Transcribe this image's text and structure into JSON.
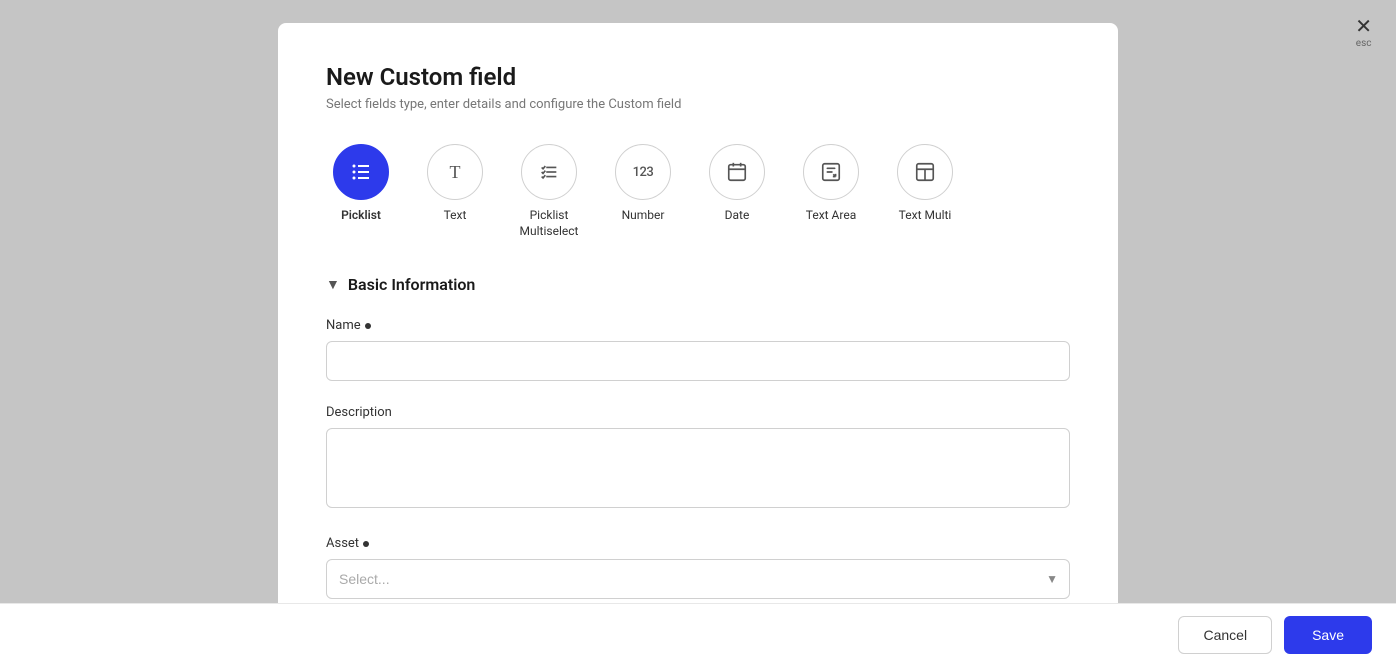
{
  "modal": {
    "title": "New Custom field",
    "subtitle": "Select fields type, enter details and configure the Custom field"
  },
  "close": {
    "icon_label": "✕",
    "esc_label": "esc"
  },
  "field_types": [
    {
      "id": "picklist",
      "label": "Picklist",
      "active": true,
      "icon": "list"
    },
    {
      "id": "text",
      "label": "Text",
      "active": false,
      "icon": "T"
    },
    {
      "id": "picklist-multiselect",
      "label": "Picklist\nMultiselect",
      "active": false,
      "icon": "list-check"
    },
    {
      "id": "number",
      "label": "Number",
      "active": false,
      "icon": "123"
    },
    {
      "id": "date",
      "label": "Date",
      "active": false,
      "icon": "calendar"
    },
    {
      "id": "text-area",
      "label": "Text Area",
      "active": false,
      "icon": "textarea"
    },
    {
      "id": "text-multi",
      "label": "Text Multi",
      "active": false,
      "icon": "text-multi"
    }
  ],
  "section": {
    "title": "Basic Information"
  },
  "form": {
    "name_label": "Name",
    "name_placeholder": "",
    "description_label": "Description",
    "description_placeholder": "",
    "asset_label": "Asset",
    "asset_placeholder": "Select..."
  },
  "footer": {
    "cancel_label": "Cancel",
    "save_label": "Save"
  }
}
